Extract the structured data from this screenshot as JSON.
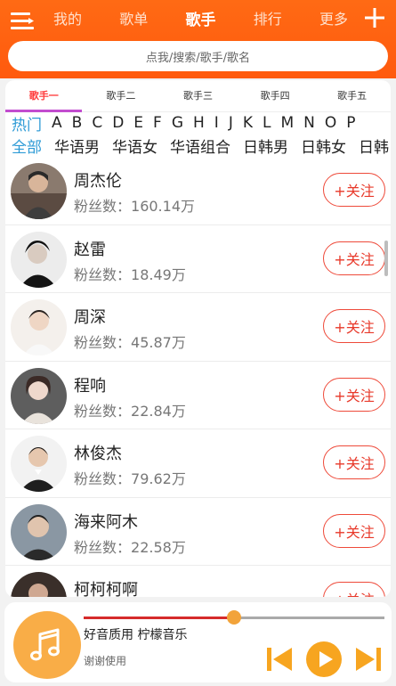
{
  "header": {
    "tabs": [
      {
        "label": "我的",
        "active": false
      },
      {
        "label": "歌单",
        "active": false
      },
      {
        "label": "歌手",
        "active": true
      },
      {
        "label": "排行",
        "active": false
      },
      {
        "label": "更多",
        "active": false
      }
    ],
    "search_placeholder": "点我/搜索/歌手/歌名",
    "icons": {
      "menu": "menu-icon",
      "add": "plus-icon"
    }
  },
  "sub_tabs": [
    "歌手一",
    "歌手二",
    "歌手三",
    "歌手四",
    "歌手五"
  ],
  "alpha_filters": [
    "热门",
    "A",
    "B",
    "C",
    "D",
    "E",
    "F",
    "G",
    "H",
    "I",
    "J",
    "K",
    "L",
    "M",
    "N",
    "O",
    "P"
  ],
  "category_filters": [
    "全部",
    "华语男",
    "华语女",
    "华语组合",
    "日韩男",
    "日韩女",
    "日韩"
  ],
  "fans_label": "粉丝数：",
  "follow_label": "+关注",
  "singers": [
    {
      "name": "周杰伦",
      "fans": "160.14万"
    },
    {
      "name": "赵雷",
      "fans": "18.49万"
    },
    {
      "name": "周深",
      "fans": "45.87万"
    },
    {
      "name": "程响",
      "fans": "22.84万"
    },
    {
      "name": "林俊杰",
      "fans": "79.62万"
    },
    {
      "name": "海来阿木",
      "fans": "22.58万"
    },
    {
      "name": "柯柯柯啊",
      "fans": ""
    }
  ],
  "player": {
    "title": "好音质用 柠檬音乐",
    "subtitle": "谢谢使用",
    "progress": 0.5
  },
  "colors": {
    "accent": "#ff5a0e",
    "selected": "#2e9bd6",
    "follow": "#e8392a",
    "play": "#f7a520"
  }
}
